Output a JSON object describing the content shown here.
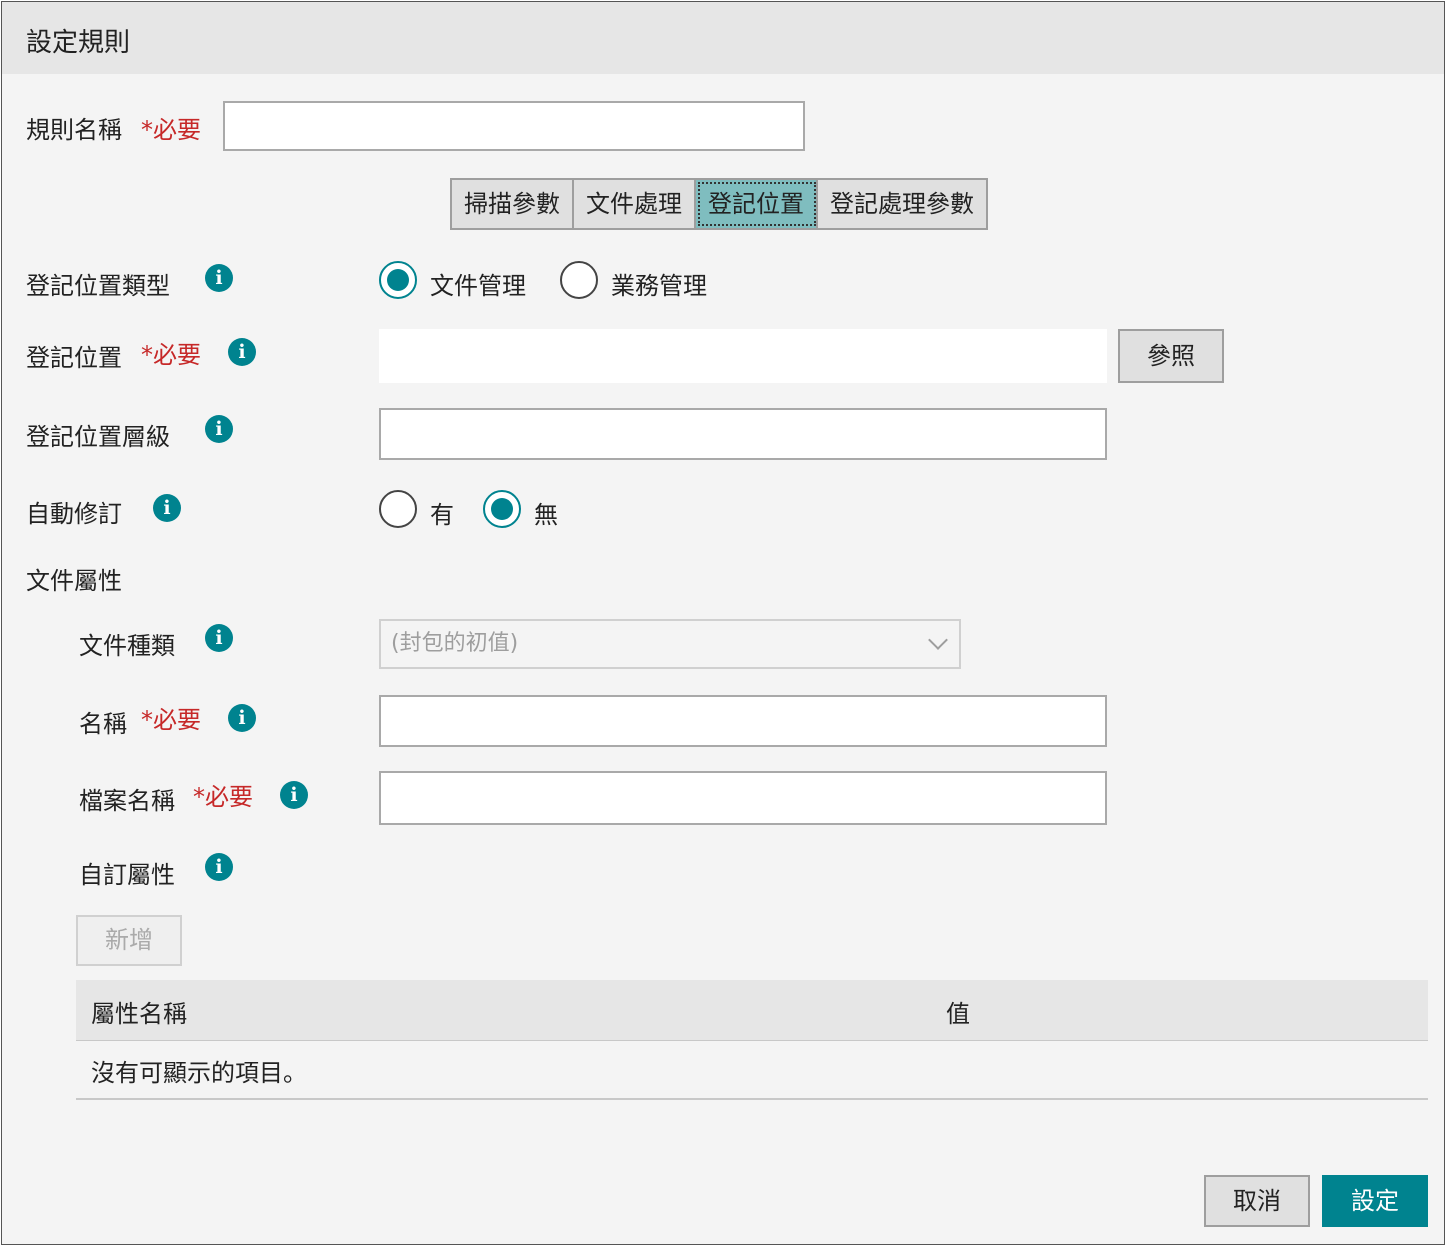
{
  "dialog": {
    "title": "設定規則",
    "rule_name_label": "規則名稱",
    "required_mark": "*必要",
    "rule_name_value": "",
    "tabs": [
      {
        "label": "掃描參數"
      },
      {
        "label": "文件處理"
      },
      {
        "label": "登記位置",
        "active": true
      },
      {
        "label": "登記處理參數"
      }
    ],
    "location_type": {
      "label": "登記位置類型",
      "options": [
        {
          "label": "文件管理",
          "selected": true
        },
        {
          "label": "業務管理",
          "selected": false
        }
      ]
    },
    "location": {
      "label": "登記位置",
      "value": "",
      "browse_label": "參照"
    },
    "location_level": {
      "label": "登記位置層級",
      "value": ""
    },
    "auto_revision": {
      "label": "自動修訂",
      "options": [
        {
          "label": "有",
          "selected": false
        },
        {
          "label": "無",
          "selected": true
        }
      ]
    },
    "doc_attributes": {
      "section_label": "文件屬性",
      "doc_type": {
        "label": "文件種類",
        "value": "(封包的初值)"
      },
      "name": {
        "label": "名稱",
        "value": ""
      },
      "file_name": {
        "label": "檔案名稱",
        "value": ""
      },
      "custom_attr": {
        "label": "自訂屬性",
        "add_label": "新增"
      },
      "table": {
        "columns": [
          "屬性名稱",
          "值"
        ],
        "empty_message": "沒有可顯示的項目。"
      }
    },
    "footer": {
      "cancel_label": "取消",
      "ok_label": "設定"
    },
    "colors": {
      "accent": "#00838f",
      "required": "#c62828"
    },
    "icons": {
      "info": "info-icon",
      "dropdown": "chevron-down-icon"
    }
  }
}
